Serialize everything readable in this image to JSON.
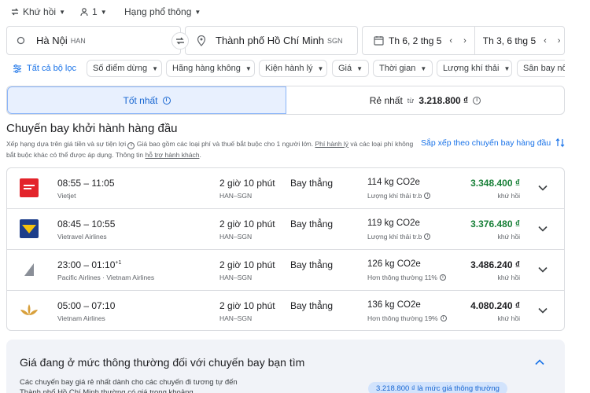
{
  "top_options": {
    "trip_type": "Khứ hồi",
    "passengers": "1",
    "cabin_class": "Hạng phổ thông"
  },
  "search": {
    "origin_city": "Hà Nội",
    "origin_code": "HAN",
    "destination_city": "Thành phố Hồ Chí Minh",
    "destination_code": "SGN",
    "depart_date": "Th 6, 2 thg 5",
    "return_date": "Th 3, 6 thg 5"
  },
  "filters": {
    "all_filters": "Tất cả bộ lọc",
    "stops": "Số điểm dừng",
    "airlines": "Hãng hàng không",
    "bags": "Kiện hành lý",
    "price": "Giá",
    "times": "Thời gian",
    "emissions": "Lượng khí thải",
    "airports": "Sân bay nối"
  },
  "tabs": {
    "best": "Tốt nhất",
    "cheapest": "Rẻ nhất",
    "cheapest_from": "từ",
    "cheapest_price": "3.218.800 ₫"
  },
  "section": {
    "title": "Chuyến bay khởi hành hàng đầu",
    "subtitle_a": "Xếp hạng dựa trên giá tiền và sự tiện lợi",
    "subtitle_b": "Giá bao gồm các loại phí và thuế bắt buộc cho 1 người lớn.",
    "subtitle_link1": "Phí hành lý",
    "subtitle_c": "và các loại phí không bắt buộc khác có thể được áp dụng. Thông tin",
    "subtitle_link2": "hỗ trợ hành khách",
    "sort_label": "Sắp xếp theo chuyến bay hàng đầu"
  },
  "flights": [
    {
      "airline": "Vietjet",
      "time": "08:55 – 11:05",
      "plus": "",
      "duration": "2 giờ 10 phút",
      "route": "HAN–SGN",
      "stops": "Bay thẳng",
      "co2": "114 kg CO2e",
      "emission_note": "Lượng khí thải tr.b",
      "price": "3.348.400 ₫",
      "price_type": "khứ hồi",
      "price_color": "#188038"
    },
    {
      "airline": "Vietravel Airlines",
      "time": "08:45 – 10:55",
      "plus": "",
      "duration": "2 giờ 10 phút",
      "route": "HAN–SGN",
      "stops": "Bay thẳng",
      "co2": "119 kg CO2e",
      "emission_note": "Lượng khí thải tr.b",
      "price": "3.376.480 ₫",
      "price_type": "khứ hồi",
      "price_color": "#188038"
    },
    {
      "airline": "Pacific Airlines · Vietnam Airlines",
      "time": "23:00 – 01:10",
      "plus": "+1",
      "duration": "2 giờ 10 phút",
      "route": "HAN–SGN",
      "stops": "Bay thẳng",
      "co2": "126 kg CO2e",
      "emission_note": "Hơn thông thường 11%",
      "price": "3.486.240 ₫",
      "price_type": "khứ hồi",
      "price_color": "#202124"
    },
    {
      "airline": "Vietnam Airlines",
      "time": "05:00 – 07:10",
      "plus": "",
      "duration": "2 giờ 10 phút",
      "route": "HAN–SGN",
      "stops": "Bay thẳng",
      "co2": "136 kg CO2e",
      "emission_note": "Hơn thông thường 19%",
      "price": "4.080.240 ₫",
      "price_type": "khứ hồi",
      "price_color": "#202124"
    }
  ],
  "insight": {
    "title_a": "Giá đang ở mức",
    "title_bold": "thông thường",
    "title_b": "đối với chuyến bay bạn tìm",
    "body": "Các chuyến bay giá rẻ nhất dành cho các chuyến đi tương tự đến Thành phố Hồ Chí Minh thường có giá trong khoảng",
    "badge": "3.218.800 ₫ là mức giá thông thường"
  },
  "colors": {
    "accent": "#1a73e8",
    "green_price": "#188038",
    "tab_active_bg": "#e8f0fe"
  }
}
